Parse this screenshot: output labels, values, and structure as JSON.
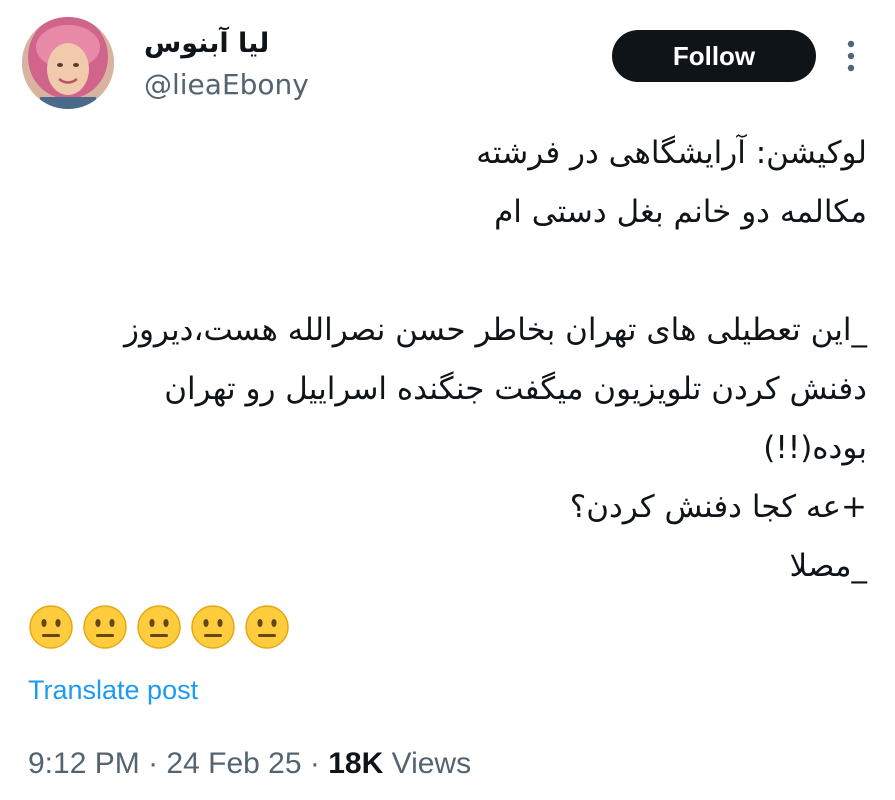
{
  "author": {
    "display_name": "لیا آبنوس",
    "handle": "@lieaEbony"
  },
  "actions": {
    "follow_label": "Follow",
    "more_icon": "more-vertical-icon"
  },
  "post": {
    "lines": [
      "لوکیشن: آرایشگاهی در فرشته",
      "مکالمه دو خانم بغل دستی ام",
      "",
      "_این تعطیلی های تهران بخاطر حسن نصرالله هست،دیروز",
      "دفنش کردن تلویزیون میگفت جنگنده اسراییل رو تهران",
      "بوده(!!)",
      "+عه کجا دفنش کردن؟",
      "_مصلا"
    ],
    "emojis": [
      "😐",
      "😐",
      "😐",
      "😐",
      "😐"
    ]
  },
  "translate_label": "Translate post",
  "meta": {
    "time": "9:12 PM",
    "separator": "·",
    "date": "24 Feb 25",
    "views_count": "18K",
    "views_label": "Views"
  },
  "colors": {
    "text": "#0f1419",
    "secondary": "#536471",
    "link": "#1d9bf0",
    "button_bg": "#0f1419"
  }
}
